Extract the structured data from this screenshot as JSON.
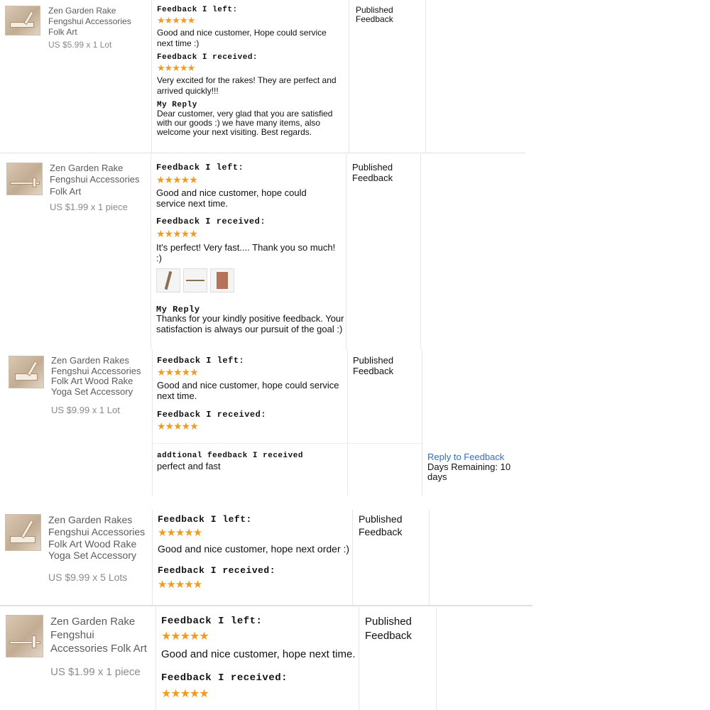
{
  "labels": {
    "left": "Feedback I left:",
    "received": "Feedback I received:",
    "reply": "My Reply",
    "stars": "★★★★★",
    "additional": "addtional feedback I received",
    "reply_link": "Reply to Feedback"
  },
  "entries": [
    {
      "product": "Zen Garden Rake Fengshui Accessories Folk Art",
      "price": "US $5.99 x 1 Lot",
      "left_text": "Good and nice customer, Hope could service next time :)",
      "received_text": "Very excited for the rakes! They are perfect and arrived quickly!!!",
      "reply_text": "Dear customer, very glad that you are satisfied with our goods :) we have many items, also welcome your next visiting. Best regards.",
      "status": "Published Feedback"
    },
    {
      "product": "Zen Garden Rake Fengshui Accessories Folk Art",
      "price": "US $1.99 x 1 piece",
      "left_text": "Good and nice customer, hope could service next time.",
      "received_text": "It's perfect! Very fast.... Thank you so much! :)",
      "reply_text": "Thanks for your kindly positive feedback. Your satisfaction is always our pursuit of the goal :)",
      "status": "Published Feedback"
    },
    {
      "product": "Zen Garden Rakes Fengshui Accessories Folk Art Wood Rake Yoga Set Accessory",
      "price": "US $9.99 x 1 Lot",
      "left_text": "Good and nice customer, hope could service next time.",
      "additional_text": "perfect and fast",
      "days_remaining": "Days Remaining: 10 days",
      "status": "Published Feedback"
    },
    {
      "product": "Zen Garden Rakes Fengshui Accessories Folk Art Wood Rake Yoga Set Accessory",
      "price": "US $9.99 x 5 Lots",
      "left_text": "Good and nice customer, hope next order :)",
      "status": "Published Feedback"
    },
    {
      "product": "Zen Garden Rake Fengshui Accessories Folk Art",
      "price": "US $1.99 x 1 piece",
      "left_text": "Good and nice customer, hope next time.",
      "status": "Published Feedback"
    }
  ]
}
